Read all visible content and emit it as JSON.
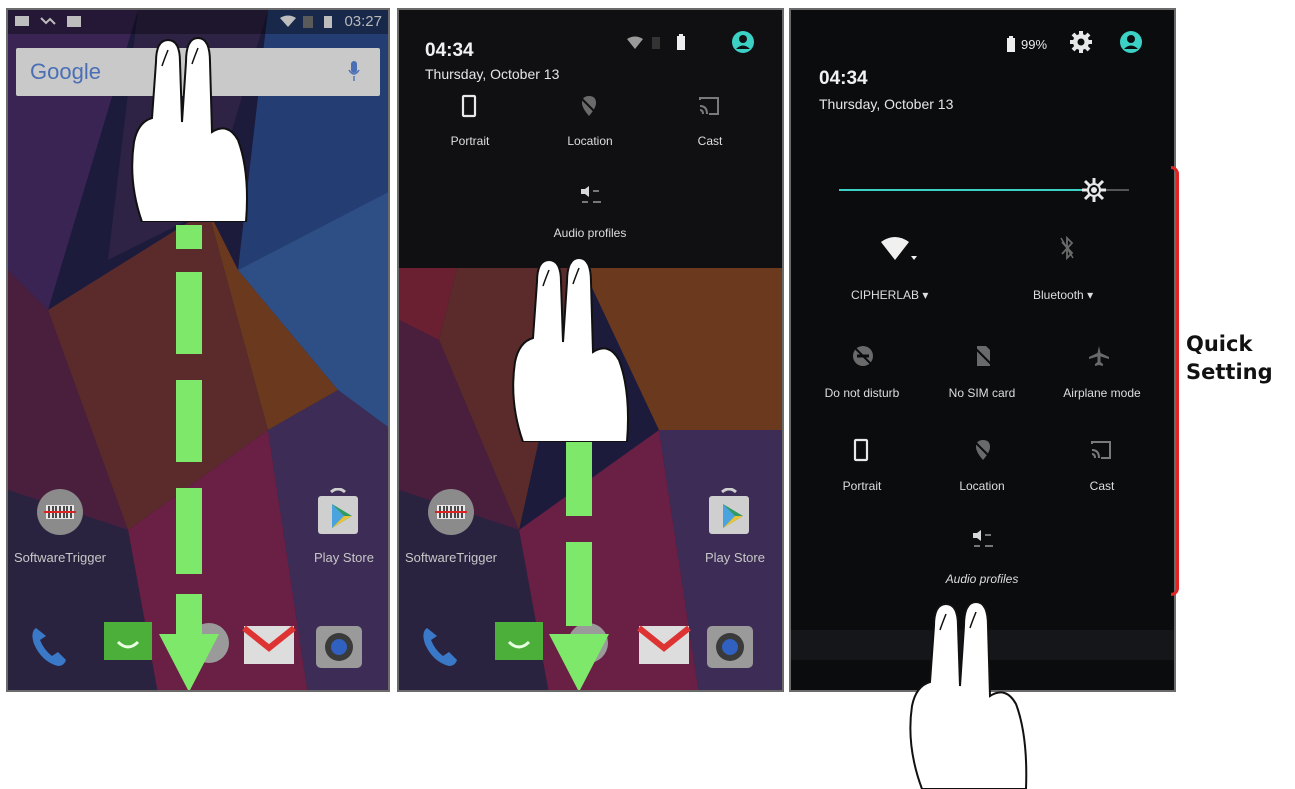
{
  "panel1": {
    "status_time": "03:27",
    "search_logo": "Google",
    "apps": [
      {
        "label": "SoftwareTrigger",
        "icon": "barcode-scanner-icon"
      },
      {
        "label": "Play Store",
        "icon": "play-store-icon"
      }
    ],
    "dock": [
      "phone-icon",
      "messaging-icon",
      "app-drawer-icon",
      "gmail-icon",
      "camera-icon"
    ]
  },
  "panel2": {
    "time": "04:34",
    "date": "Thursday, October 13",
    "tiles": [
      {
        "label": "Portrait",
        "icon": "portrait-icon"
      },
      {
        "label": "Location",
        "icon": "location-off-icon"
      },
      {
        "label": "Cast",
        "icon": "cast-icon"
      }
    ],
    "audio_label": "Audio profiles",
    "apps": [
      {
        "label": "SoftwareTrigger"
      },
      {
        "label": "Play Store"
      }
    ]
  },
  "panel3": {
    "battery_text": "99%",
    "time": "04:34",
    "date": "Thursday, October 13",
    "brightness_level": 0.88,
    "wifi_label": "CIPHERLAB",
    "bluetooth_label": "Bluetooth",
    "tiles_row2": [
      {
        "label": "Do not disturb",
        "icon": "do-not-disturb-icon"
      },
      {
        "label": "No SIM card",
        "icon": "no-sim-icon"
      },
      {
        "label": "Airplane mode",
        "icon": "airplane-icon"
      }
    ],
    "tiles_row3": [
      {
        "label": "Portrait",
        "icon": "portrait-icon"
      },
      {
        "label": "Location",
        "icon": "location-off-icon"
      },
      {
        "label": "Cast",
        "icon": "cast-icon"
      }
    ],
    "audio_label": "Audio profiles"
  },
  "callout": {
    "line1": "Quick",
    "line2": "Setting"
  },
  "colors": {
    "arrow": "#7ee86b",
    "bracket": "#e02424",
    "accent": "#3bd1c4"
  }
}
